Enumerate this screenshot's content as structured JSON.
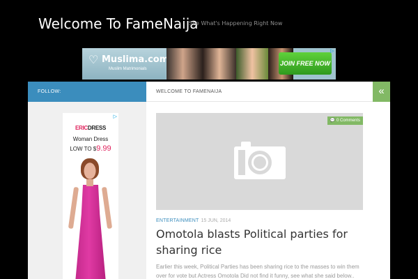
{
  "header": {
    "site_title": "Welcome To FameNaija",
    "tagline": "See What's Happening Right Now"
  },
  "top_ad": {
    "brand": "Muslima.com",
    "brand_sub": "Muslim Matrimonials",
    "cta": "JOIN FREE NOW"
  },
  "sidebar": {
    "follow_label": "FOLLOW:",
    "ad": {
      "brand_part1": "ERIC",
      "brand_part2": "DRESS",
      "product": "Woman Dress",
      "price_prefix": "LOW TO $",
      "price": "9.99"
    }
  },
  "main": {
    "header_label": "WELCOME TO FAMENAIJA",
    "toggle_icon": "double-chevron-left-icon",
    "post": {
      "comments": "0 Comments",
      "category": "ENTERTAINMENT",
      "date": "15 JUN, 2014",
      "title": "Omotola blasts Political parties for sharing rice",
      "excerpt": "Earlier this week, Political Parties has been sharing rice to the masses to win them over for vote but Actress Omotola Did not find it funny, see what she said below.. Rice"
    }
  },
  "colors": {
    "accent_blue": "#3b8dbd",
    "accent_green": "#82b965",
    "background": "#000000"
  }
}
